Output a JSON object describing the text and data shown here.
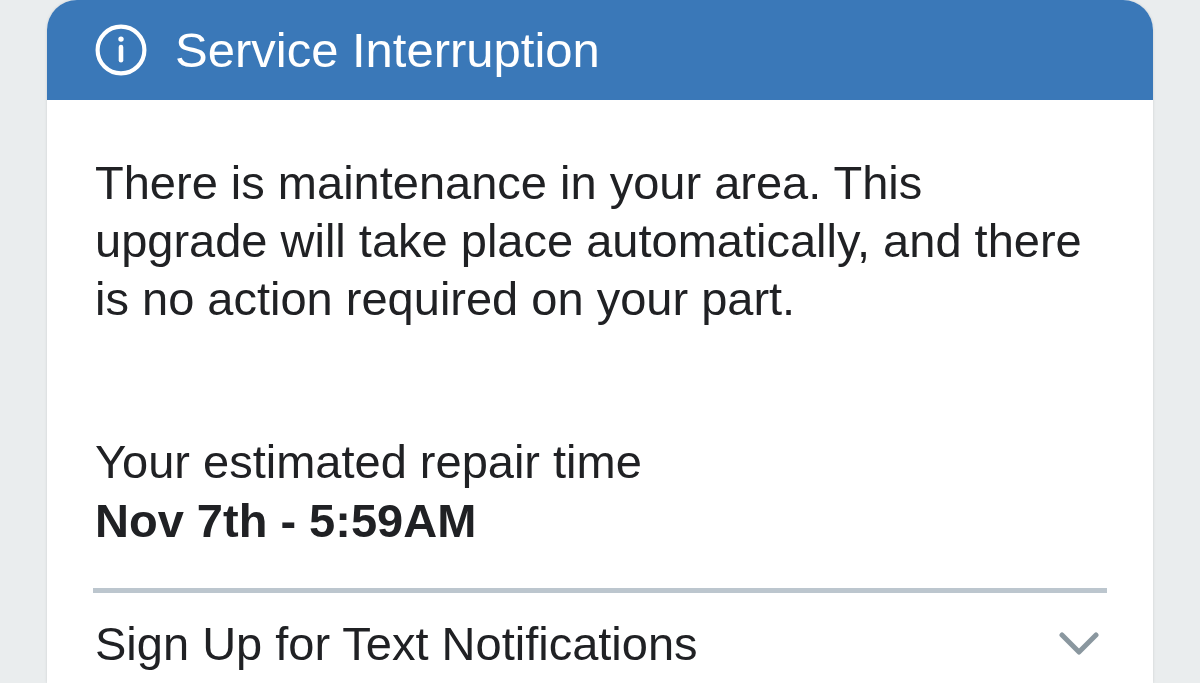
{
  "alert": {
    "title": "Service Interruption",
    "message": "There is maintenance in your area. This upgrade will take place automatically, and there is no action required on your part.",
    "estimate_label": "Your estimated repair time",
    "estimate_value": "Nov 7th - 5:59AM"
  },
  "notifications": {
    "label": "Sign Up for Text Notifications",
    "expanded": false
  }
}
